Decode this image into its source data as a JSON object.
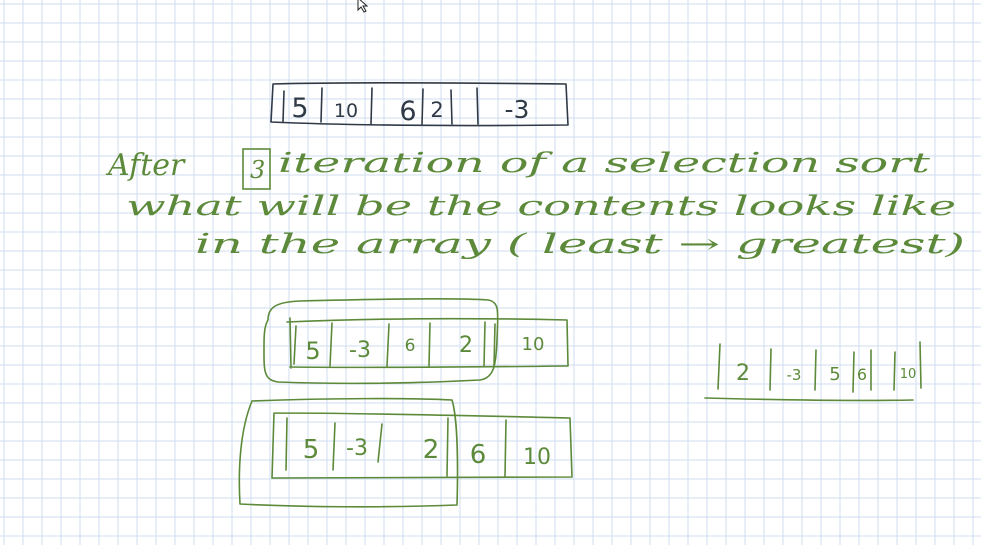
{
  "colors": {
    "grid": "#cfdcef",
    "ink_dark": "#303a47",
    "ink_green": "#5c8a3a",
    "background": "#ffffff"
  },
  "cursor_icon": "mouse-pointer-icon",
  "original_array": [
    "5",
    "10",
    "6",
    "2",
    "-3"
  ],
  "question": {
    "line1_before": "After",
    "boxed_number": "3",
    "line1_after": "iteration of a selection sort",
    "line2": "what will be the contents looks like",
    "line3": "in the array ( least → greatest)"
  },
  "iteration_1": [
    "5",
    "-3",
    "6",
    "2",
    "10"
  ],
  "iteration_2": [
    "5",
    "-3",
    "2",
    "6",
    "10"
  ],
  "answer": [
    "2",
    "-3",
    "5",
    "6",
    "10"
  ]
}
